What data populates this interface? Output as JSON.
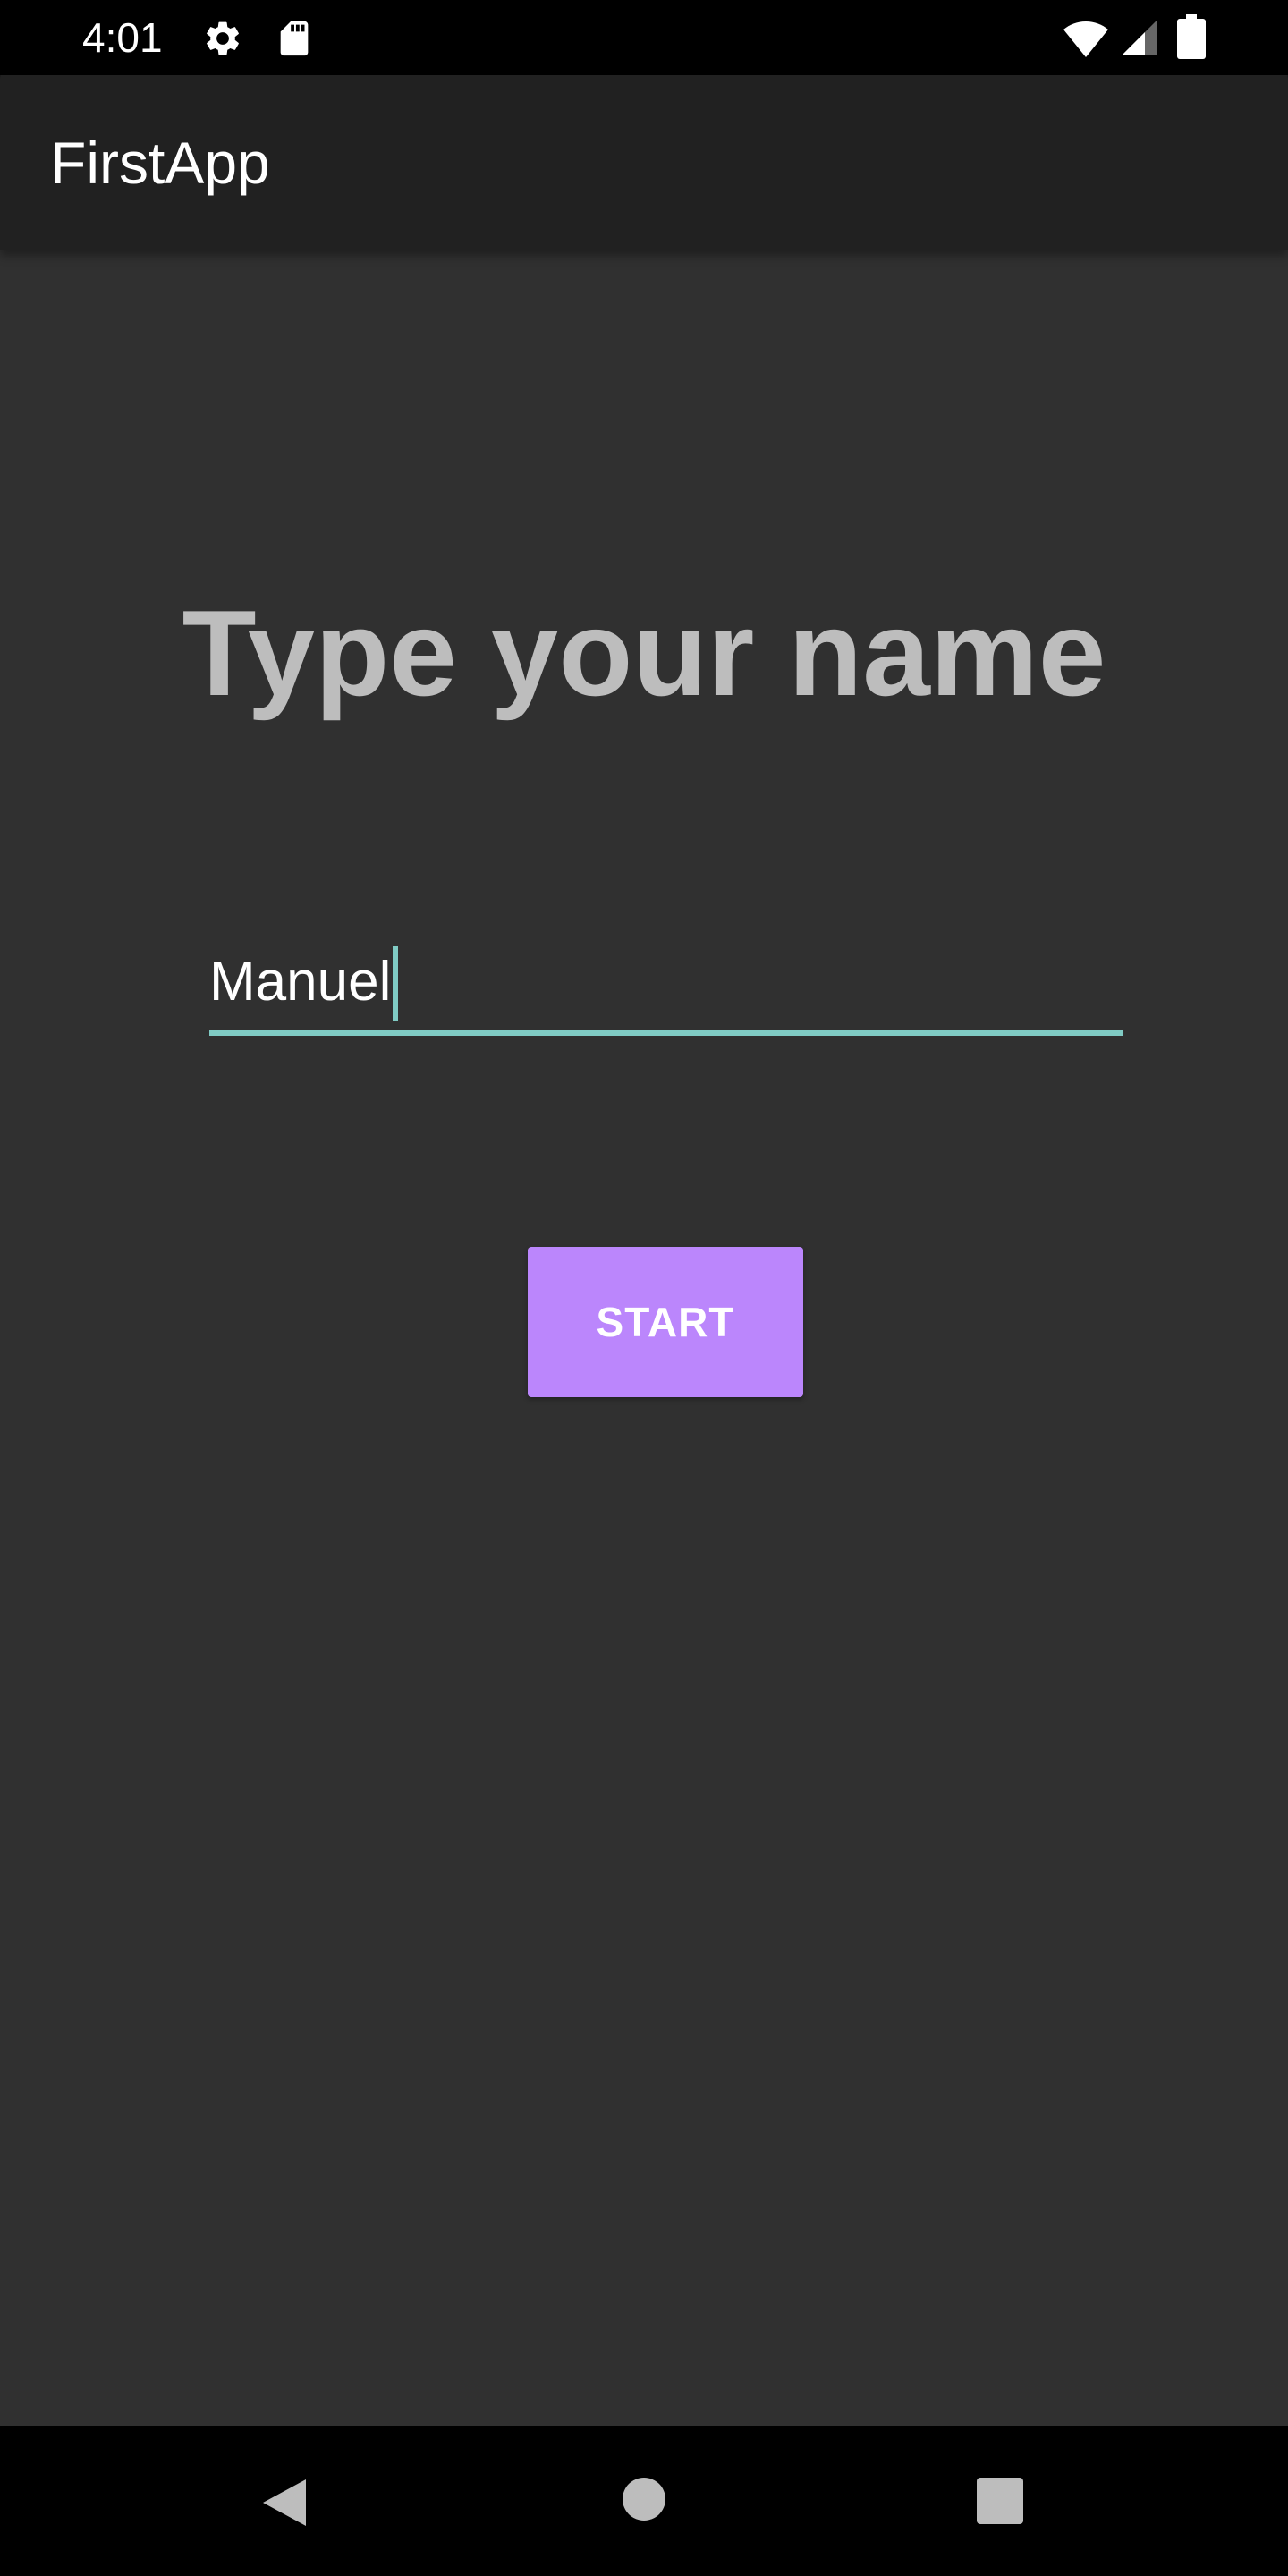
{
  "status_bar": {
    "time": "4:01",
    "icons": [
      "gear-icon",
      "sd-card-icon",
      "wifi-icon",
      "cell-signal-icon",
      "battery-icon"
    ]
  },
  "app_bar": {
    "title": "FirstApp"
  },
  "main": {
    "heading": "Type your name",
    "name_input": {
      "value": "Manuel"
    },
    "start_button_label": "START"
  },
  "nav_bar": {
    "buttons": [
      "back-icon",
      "home-icon",
      "recents-icon"
    ]
  },
  "colors": {
    "app_bar": "#212121",
    "background": "#303030",
    "heading": "#bdbdbd",
    "accent": "#80cbc4",
    "button": "#bb86fc",
    "button_text": "#ffffff"
  }
}
